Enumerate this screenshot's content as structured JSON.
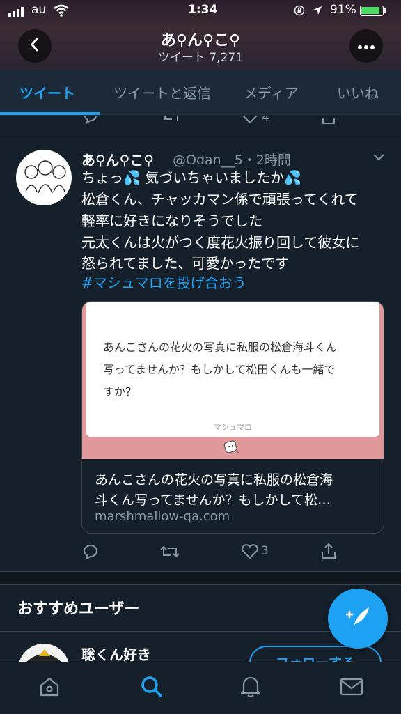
{
  "status_bar": {
    "carrier": "au",
    "time": "1:34",
    "battery_percent": "91%",
    "battery_level": 0.91
  },
  "header": {
    "name": "あ⚲ん⚲こ⚲",
    "tweet_count": "ツイート 7,271"
  },
  "tabs": [
    {
      "label": "ツイート",
      "active": true
    },
    {
      "label": "ツイートと返信",
      "active": false
    },
    {
      "label": "メディア",
      "active": false
    },
    {
      "label": "いいね",
      "active": false
    }
  ],
  "prev_tweet": {
    "like_count": "4"
  },
  "tweet": {
    "display_name": "あ⚲ん⚲こ⚲",
    "handle_time": "@Odan__5・2時間",
    "lines": [
      "ちょっ💦 気づいちゃいましたか💦",
      "松倉くん、チャッカマン係で頑張ってくれて",
      "軽率に好きになりそうでした",
      "元太くんは火がつく度花火振り回して彼女に",
      "怒られてました、可愛かったです"
    ],
    "hashtag": "#マシュマロを投げ合おう",
    "card": {
      "image_text_lines": [
        "あんこさんの花火の写真に私服の松倉海斗くん",
        "写ってませんか？もしかして松田くんも一緒で",
        "すか？"
      ],
      "image_brand": "マシュマロ",
      "title_lines": [
        "あんこさんの花火の写真に私服の松倉海",
        "斗くん写ってませんか？もしかして松…"
      ],
      "domain": "marshmallow-qa.com"
    },
    "like_count": "3"
  },
  "recommended": {
    "section_title": "おすすめユーザー",
    "user_name": "聡くん好き",
    "follow_label": "フォローする"
  },
  "colors": {
    "accent": "#1da1f2",
    "background": "#15202b",
    "muted": "#8899a6",
    "card_pink": "#e0989a"
  },
  "icons": {
    "back": "chevron-left-icon",
    "more": "more-horizontal-icon",
    "compose": "compose-feather-icon",
    "nav": [
      "home-icon",
      "search-icon",
      "notifications-icon",
      "messages-icon"
    ]
  }
}
